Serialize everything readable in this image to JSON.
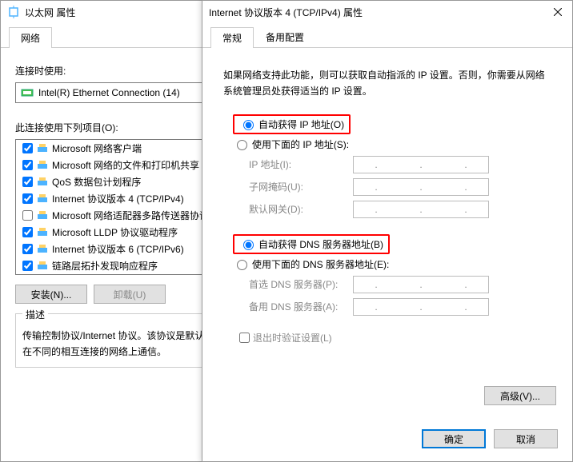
{
  "left": {
    "title": "以太网 属性",
    "tab": "网络",
    "connect_using_label": "连接时使用:",
    "adapter": "Intel(R) Ethernet Connection (14)",
    "items_label": "此连接使用下列项目(O):",
    "items": [
      {
        "checked": true,
        "label": "Microsoft 网络客户端"
      },
      {
        "checked": true,
        "label": "Microsoft 网络的文件和打印机共享"
      },
      {
        "checked": true,
        "label": "QoS 数据包计划程序"
      },
      {
        "checked": true,
        "label": "Internet 协议版本 4 (TCP/IPv4)"
      },
      {
        "checked": false,
        "label": "Microsoft 网络适配器多路传送器协议"
      },
      {
        "checked": true,
        "label": "Microsoft LLDP 协议驱动程序"
      },
      {
        "checked": true,
        "label": "Internet 协议版本 6 (TCP/IPv6)"
      },
      {
        "checked": true,
        "label": "链路层拓扑发现响应程序"
      }
    ],
    "install_btn": "安装(N)...",
    "uninstall_btn": "卸载(U)",
    "desc_title": "描述",
    "desc_text": "传输控制协议/Internet 协议。该协议是默认的广域网络协议，用于在不同的相互连接的网络上通信。"
  },
  "right": {
    "title": "Internet 协议版本 4 (TCP/IPv4) 属性",
    "tabs": {
      "general": "常规",
      "alt": "备用配置"
    },
    "info": "如果网络支持此功能，则可以获取自动指派的 IP 设置。否则，你需要从网络系统管理员处获得适当的 IP 设置。",
    "ip_auto": "自动获得 IP 地址(O)",
    "ip_manual": "使用下面的 IP 地址(S):",
    "ip_addr": "IP 地址(I):",
    "subnet": "子网掩码(U):",
    "gateway": "默认网关(D):",
    "dns_auto": "自动获得 DNS 服务器地址(B)",
    "dns_manual": "使用下面的 DNS 服务器地址(E):",
    "dns_pref": "首选 DNS 服务器(P):",
    "dns_alt": "备用 DNS 服务器(A):",
    "validate": "退出时验证设置(L)",
    "advanced": "高级(V)...",
    "ok": "确定",
    "cancel": "取消"
  }
}
